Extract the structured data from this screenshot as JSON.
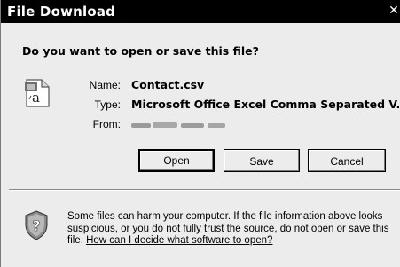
{
  "window": {
    "title": "File Download",
    "close_glyph": "✕"
  },
  "prompt": {
    "question": "Do you want to open or save this file?"
  },
  "file": {
    "icon": "csv-file-icon",
    "name_label": "Name:",
    "name_value": "Contact.csv",
    "type_label": "Type:",
    "type_value": "Microsoft Office Excel Comma Separated V...",
    "from_label": "From:"
  },
  "buttons": {
    "open": "Open",
    "save": "Save",
    "cancel": "Cancel"
  },
  "warning": {
    "icon": "shield-question-icon",
    "text": "Some files can harm your computer. If the file information above looks suspicious, or you do not fully trust the source, do not open or save this file. ",
    "link": "How can I decide what software to open?"
  }
}
